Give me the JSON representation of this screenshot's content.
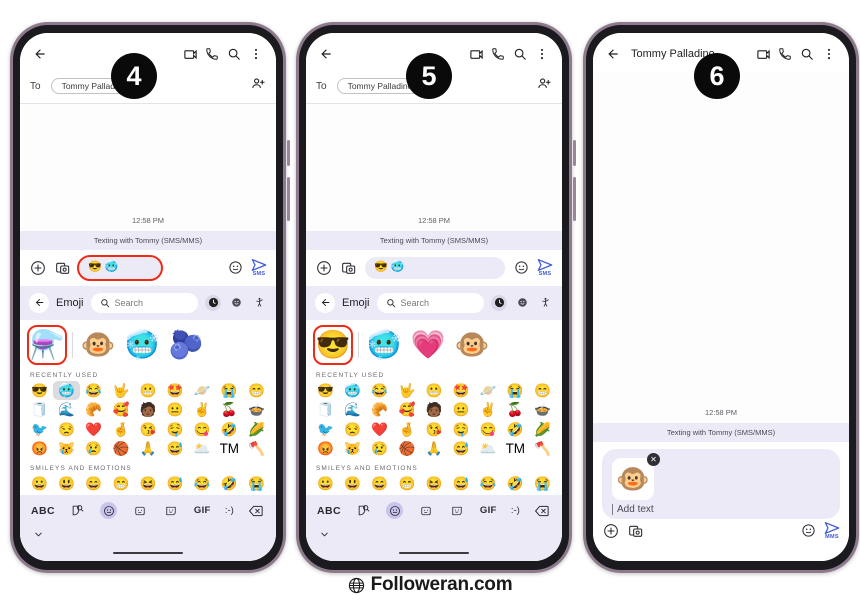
{
  "footer": {
    "brand": "Followeran.com",
    "icon": "globe-icon"
  },
  "badges": {
    "four": "4",
    "five": "5",
    "six": "6"
  },
  "colors": {
    "accent_blue": "#3f5bd4",
    "highlight_red": "#ee2b17",
    "panel_lavender": "#eceaf6",
    "selected_tab": "#c9c4ec",
    "bezel_purple": "#8d7a8c"
  },
  "phone1": {
    "appbar": {
      "back": "back-arrow",
      "video": "video-call-icon",
      "call": "phone-call-icon",
      "search": "search-icon",
      "more": "more-options-icon"
    },
    "to_row": {
      "label": "To",
      "chip": "Tommy Palladino",
      "add_person": "add-person-icon"
    },
    "thread": {
      "timestamp": "12:58 PM",
      "banner": "Texting with Tommy (SMS/MMS)"
    },
    "compose": {
      "plus": "plus-icon",
      "gallery": "gallery-icon",
      "input_emojis": [
        "😎",
        "🥶"
      ],
      "emoji_btn": "emoji-icon",
      "send_label": "SMS"
    },
    "emoji_panel": {
      "back": "back-arrow",
      "title": "Emoji",
      "search_placeholder": "Search",
      "tabs": [
        {
          "name": "recent-tab",
          "glyph": "🕐",
          "selected": true
        },
        {
          "name": "smiley-tab",
          "glyph": "☺",
          "selected": false
        },
        {
          "name": "people-tab",
          "glyph": "🧍",
          "selected": false
        }
      ],
      "suggestions": [
        "⚗️",
        "🐵",
        "🥶",
        "🫐"
      ],
      "boxed_suggestion_index": 0,
      "section_recent": "RECENTLY USED",
      "recent_rows": [
        [
          "😎",
          "🥶",
          "😂",
          "🤟",
          "😬",
          "🤩",
          "🪐",
          "😭",
          "😁"
        ],
        [
          "🧻",
          "🌊",
          "🥐",
          "🥰",
          "🧑🏾",
          "😐",
          "✌️",
          "🍒",
          "🍲"
        ],
        [
          "🐦",
          "😒",
          "❤️",
          "🤞",
          "😘",
          "🤤",
          "😋",
          "🤣",
          "🌽"
        ],
        [
          "😡",
          "😿",
          "😢",
          "🏀",
          "🙏",
          "😅",
          "🌥️",
          "TM",
          "🪓"
        ]
      ],
      "selected_recent": {
        "row": 0,
        "col": 1
      },
      "section_smileys": "SMILEYS AND EMOTIONS",
      "smiley_row": [
        "😀",
        "😃",
        "😄",
        "😁",
        "😆",
        "😅",
        "😂",
        "🤣",
        "😭"
      ]
    },
    "keyboard_bar": {
      "abc": "ABC",
      "sticker": "sticker-search-icon",
      "emoji": "emoji-icon",
      "emoticon": "emoticon-icon",
      "avatar": "avatar-sticker-icon",
      "gif": "GIF",
      "kaomoji": ":-)",
      "backspace": "backspace-icon"
    },
    "collapse": "chevron-down-icon"
  },
  "phone2": {
    "appbar": {
      "back": "back-arrow",
      "video": "video-call-icon",
      "call": "phone-call-icon",
      "search": "search-icon",
      "more": "more-options-icon"
    },
    "to_row": {
      "label": "To",
      "chip": "Tommy Palladino",
      "add_person": "add-person-icon"
    },
    "thread": {
      "timestamp": "12:58 PM",
      "banner": "Texting with Tommy (SMS/MMS)"
    },
    "compose": {
      "plus": "plus-icon",
      "gallery": "gallery-icon",
      "input_emojis": [
        "😎",
        "🥶"
      ],
      "emoji_btn": "emoji-icon",
      "send_label": "SMS"
    },
    "emoji_panel": {
      "back": "back-arrow",
      "title": "Emoji",
      "search_placeholder": "Search",
      "tabs": [
        {
          "name": "recent-tab",
          "glyph": "🕐",
          "selected": true
        },
        {
          "name": "smiley-tab",
          "glyph": "☺",
          "selected": false
        },
        {
          "name": "people-tab",
          "glyph": "🧍",
          "selected": false
        }
      ],
      "suggestions": [
        "😎",
        "🥶",
        "💗",
        "🐵"
      ],
      "boxed_suggestion_index": 0,
      "section_recent": "RECENTLY USED",
      "recent_rows": [
        [
          "😎",
          "🥶",
          "😂",
          "🤟",
          "😬",
          "🤩",
          "🪐",
          "😭",
          "😁"
        ],
        [
          "🧻",
          "🌊",
          "🥐",
          "🥰",
          "🧑🏾",
          "😐",
          "✌️",
          "🍒",
          "🍲"
        ],
        [
          "🐦",
          "😒",
          "❤️",
          "🤞",
          "😘",
          "🤤",
          "😋",
          "🤣",
          "🌽"
        ],
        [
          "😡",
          "😿",
          "😢",
          "🏀",
          "🙏",
          "😅",
          "🌥️",
          "TM",
          "🪓"
        ]
      ],
      "selected_recent": null,
      "section_smileys": "SMILEYS AND EMOTIONS",
      "smiley_row": [
        "😀",
        "😃",
        "😄",
        "😁",
        "😆",
        "😅",
        "😂",
        "🤣",
        "😭"
      ]
    },
    "keyboard_bar": {
      "abc": "ABC",
      "sticker": "sticker-search-icon",
      "emoji": "emoji-icon",
      "emoticon": "emoticon-icon",
      "avatar": "avatar-sticker-icon",
      "gif": "GIF",
      "kaomoji": ":-)",
      "backspace": "backspace-icon"
    },
    "collapse": "chevron-down-icon"
  },
  "phone3": {
    "appbar": {
      "back": "back-arrow",
      "title": "Tommy Palladino",
      "video": "video-call-icon",
      "call": "phone-call-icon",
      "search": "search-icon",
      "more": "more-options-icon"
    },
    "thread": {
      "timestamp": "12:58 PM",
      "banner": "Texting with Tommy (SMS/MMS)"
    },
    "attachment": {
      "sticker": "🐵",
      "remove": "remove-attachment-icon"
    },
    "compose": {
      "plus": "plus-icon",
      "gallery": "gallery-icon",
      "placeholder": "Add text",
      "emoji_btn": "emoji-icon",
      "send_label": "MMS"
    }
  }
}
